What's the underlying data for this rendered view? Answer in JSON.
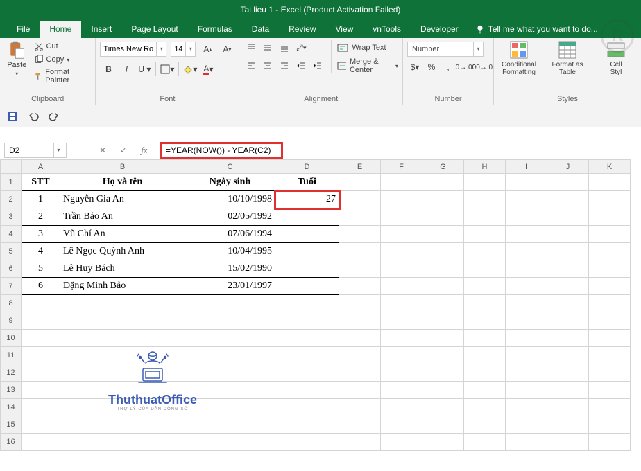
{
  "title": "Tai lieu 1 - Excel (Product Activation Failed)",
  "tabs": {
    "file": "File",
    "home": "Home",
    "insert": "Insert",
    "pagelayout": "Page Layout",
    "formulas": "Formulas",
    "data": "Data",
    "review": "Review",
    "view": "View",
    "vntools": "vnTools",
    "developer": "Developer",
    "tellme": "Tell me what you want to do..."
  },
  "ribbon": {
    "clipboard": {
      "paste": "Paste",
      "cut": "Cut",
      "copy": "Copy",
      "fmtpainter": "Format Painter",
      "label": "Clipboard"
    },
    "font": {
      "name": "Times New Roma",
      "size": "14",
      "label": "Font"
    },
    "alignment": {
      "wrap": "Wrap Text",
      "merge": "Merge & Center",
      "label": "Alignment"
    },
    "number": {
      "format": "Number",
      "label": "Number"
    },
    "styles": {
      "cond": "Conditional\nFormatting",
      "fmtas": "Format as\nTable",
      "cell": "Cell\nStyl",
      "label": "Styles"
    }
  },
  "namebox": "D2",
  "formula": "=YEAR(NOW()) - YEAR(C2)",
  "cols": [
    "A",
    "B",
    "C",
    "D",
    "E",
    "F",
    "G",
    "H",
    "I",
    "J",
    "K"
  ],
  "rows_blank": [
    8,
    9,
    10,
    11,
    12,
    13,
    14,
    15,
    16
  ],
  "header": {
    "stt": "STT",
    "name": "Họ và tên",
    "dob": "Ngày sinh",
    "age": "Tuổi"
  },
  "data": [
    {
      "stt": "1",
      "name": "Nguyễn Gia An",
      "dob": "10/10/1998",
      "age": "27"
    },
    {
      "stt": "2",
      "name": "Trần Bảo An",
      "dob": "02/05/1992",
      "age": ""
    },
    {
      "stt": "3",
      "name": "Vũ Chí An",
      "dob": "07/06/1994",
      "age": ""
    },
    {
      "stt": "4",
      "name": "Lê Ngọc Quỳnh Anh",
      "dob": "10/04/1995",
      "age": ""
    },
    {
      "stt": "5",
      "name": "Lê Huy Bách",
      "dob": "15/02/1990",
      "age": ""
    },
    {
      "stt": "6",
      "name": "Đặng Minh Bảo",
      "dob": "23/01/1997",
      "age": ""
    }
  ],
  "logo": {
    "brand": "ThuthuatOffice",
    "tag": "TRỢ LÝ CỦA DÂN CÔNG SỞ"
  }
}
